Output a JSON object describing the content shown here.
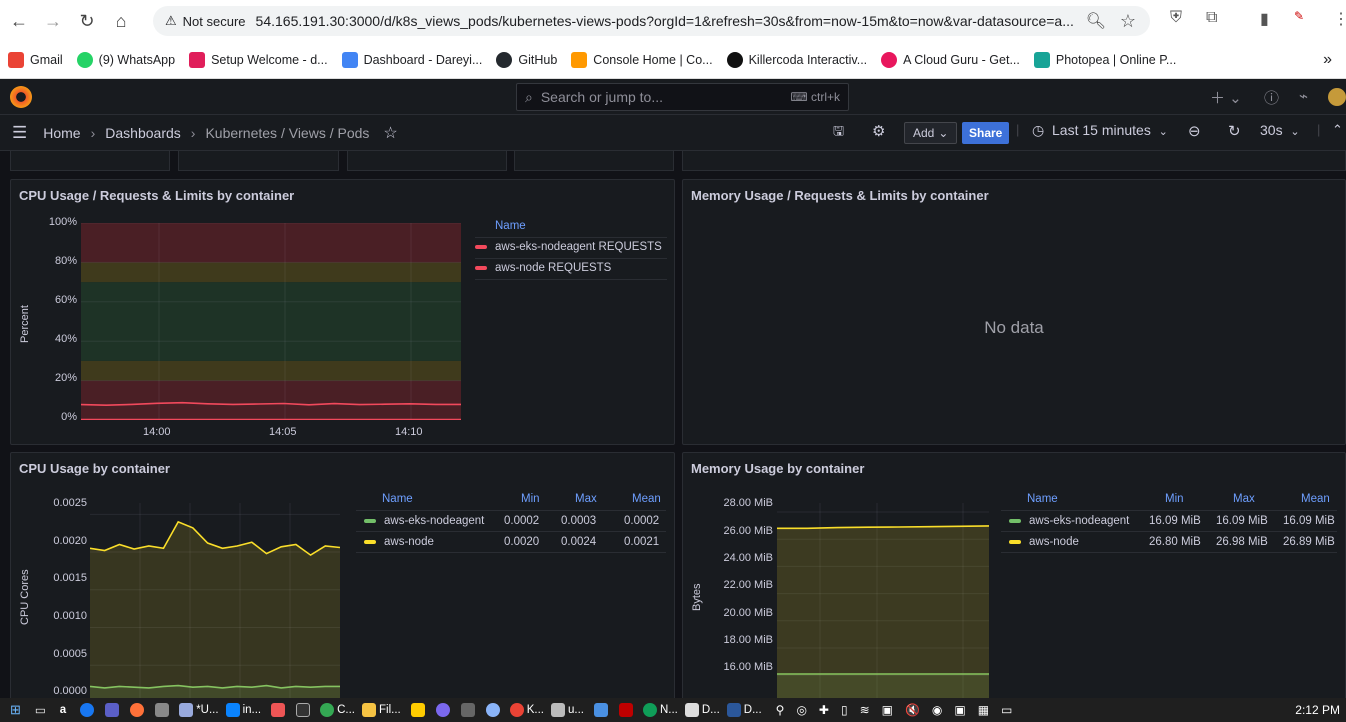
{
  "browser": {
    "not_secure": "Not secure",
    "url": "54.165.191.30:3000/d/k8s_views_pods/kubernetes-views-pods?orgId=1&refresh=30s&from=now-15m&to=now&var-datasource=a...",
    "bookmarks": [
      {
        "label": "Gmail",
        "color": "#ea4335"
      },
      {
        "label": "(9) WhatsApp",
        "color": "#25d366"
      },
      {
        "label": "Setup Welcome - d...",
        "color": "#e01e5a"
      },
      {
        "label": "Dashboard - Dareyi...",
        "color": "#4285f4"
      },
      {
        "label": "GitHub",
        "color": "#24292e"
      },
      {
        "label": "Console Home | Co...",
        "color": "#ff9900"
      },
      {
        "label": "Killercoda Interactiv...",
        "color": "#111111"
      },
      {
        "label": "A Cloud Guru - Get...",
        "color": "#e8175d"
      },
      {
        "label": "Photopea | Online P...",
        "color": "#18a497"
      }
    ]
  },
  "grafana": {
    "search_placeholder": "Search or jump to...",
    "search_shortcut": "ctrl+k",
    "breadcrumb": [
      "Home",
      "Dashboards",
      "Kubernetes / Views / Pods"
    ],
    "add_label": "Add",
    "share_label": "Share",
    "time_range": "Last 15 minutes",
    "refresh_interval": "30s"
  },
  "panels": {
    "cpu_req": {
      "title": "CPU Usage / Requests & Limits by container",
      "ylabel": "Percent",
      "yticks": [
        "100%",
        "80%",
        "60%",
        "40%",
        "20%",
        "0%"
      ],
      "xticks": [
        "14:00",
        "14:05",
        "14:10"
      ],
      "legend_header": "Name",
      "legend": [
        {
          "name": "aws-eks-nodeagent REQUESTS",
          "color": "#f2495c"
        },
        {
          "name": "aws-node REQUESTS",
          "color": "#f2495c"
        }
      ]
    },
    "mem_req": {
      "title": "Memory Usage / Requests & Limits by container",
      "no_data": "No data"
    },
    "cpu_usage": {
      "title": "CPU Usage by container",
      "ylabel": "CPU Cores",
      "yticks": [
        "0.0025",
        "0.0020",
        "0.0015",
        "0.0010",
        "0.0005",
        "0.0000"
      ],
      "legend_headers": [
        "Name",
        "Min",
        "Max",
        "Mean"
      ],
      "legend": [
        {
          "name": "aws-eks-nodeagent",
          "min": "0.0002",
          "max": "0.0003",
          "mean": "0.0002",
          "color": "#73bf69"
        },
        {
          "name": "aws-node",
          "min": "0.0020",
          "max": "0.0024",
          "mean": "0.0021",
          "color": "#fade2a"
        }
      ]
    },
    "mem_usage": {
      "title": "Memory Usage by container",
      "ylabel": "Bytes",
      "yticks": [
        "28.00 MiB",
        "26.00 MiB",
        "24.00 MiB",
        "22.00 MiB",
        "20.00 MiB",
        "18.00 MiB",
        "16.00 MiB"
      ],
      "legend_headers": [
        "Name",
        "Min",
        "Max",
        "Mean"
      ],
      "legend": [
        {
          "name": "aws-eks-nodeagent",
          "min": "16.09 MiB",
          "max": "16.09 MiB",
          "mean": "16.09 MiB",
          "color": "#73bf69"
        },
        {
          "name": "aws-node",
          "min": "26.80 MiB",
          "max": "26.98 MiB",
          "mean": "26.89 MiB",
          "color": "#fade2a"
        }
      ]
    }
  },
  "chart_data": [
    {
      "type": "line",
      "title": "CPU Usage / Requests & Limits by container",
      "ylabel": "Percent",
      "ylim": [
        0,
        100
      ],
      "x": [
        "13:57",
        "13:58",
        "13:59",
        "14:00",
        "14:01",
        "14:02",
        "14:03",
        "14:04",
        "14:05",
        "14:06",
        "14:07",
        "14:08",
        "14:09",
        "14:10",
        "14:11",
        "14:12"
      ],
      "series": [
        {
          "name": "aws-eks-nodeagent REQUESTS",
          "values": [
            0.2,
            0.2,
            0.2,
            0.2,
            0.2,
            0.2,
            0.2,
            0.2,
            0.2,
            0.2,
            0.2,
            0.2,
            0.2,
            0.2,
            0.2,
            0.2
          ]
        },
        {
          "name": "aws-node REQUESTS",
          "values": [
            7.8,
            7.5,
            7.9,
            8.5,
            8.8,
            8.2,
            7.9,
            8.1,
            8.4,
            7.7,
            8.3,
            7.8,
            8.0,
            8.2,
            7.9,
            7.9
          ]
        }
      ]
    },
    {
      "type": "line",
      "title": "CPU Usage by container",
      "ylabel": "CPU Cores",
      "ylim": [
        0,
        0.0025
      ],
      "series": [
        {
          "name": "aws-eks-nodeagent",
          "values": [
            0.00022,
            0.0002,
            0.00022,
            0.00021,
            0.0002,
            0.00022,
            0.00023,
            0.00021,
            0.00022,
            0.0002,
            0.00022,
            0.00021,
            0.00023,
            0.0002,
            0.00022,
            0.00021,
            0.00022,
            0.00022
          ]
        },
        {
          "name": "aws-node",
          "values": [
            0.00205,
            0.00202,
            0.0021,
            0.00204,
            0.00208,
            0.00205,
            0.0024,
            0.00232,
            0.00212,
            0.00205,
            0.00208,
            0.00213,
            0.00198,
            0.00207,
            0.0021,
            0.00196,
            0.00208,
            0.00206
          ]
        }
      ]
    },
    {
      "type": "area",
      "title": "Memory Usage by container",
      "ylabel": "Bytes",
      "ylim": [
        15,
        28.5
      ],
      "series": [
        {
          "name": "aws-eks-nodeagent",
          "values": [
            16.09,
            16.09,
            16.09,
            16.09,
            16.09,
            16.09,
            16.09,
            16.09
          ]
        },
        {
          "name": "aws-node",
          "values": [
            26.8,
            26.8,
            26.85,
            26.88,
            26.9,
            26.92,
            26.95,
            26.98
          ]
        }
      ]
    }
  ],
  "taskbar": {
    "items": [
      "*U...",
      "in...",
      "C...",
      "Fil...",
      "K...",
      "u...",
      "N...",
      "D...",
      "D..."
    ],
    "clock": "2:12 PM"
  }
}
